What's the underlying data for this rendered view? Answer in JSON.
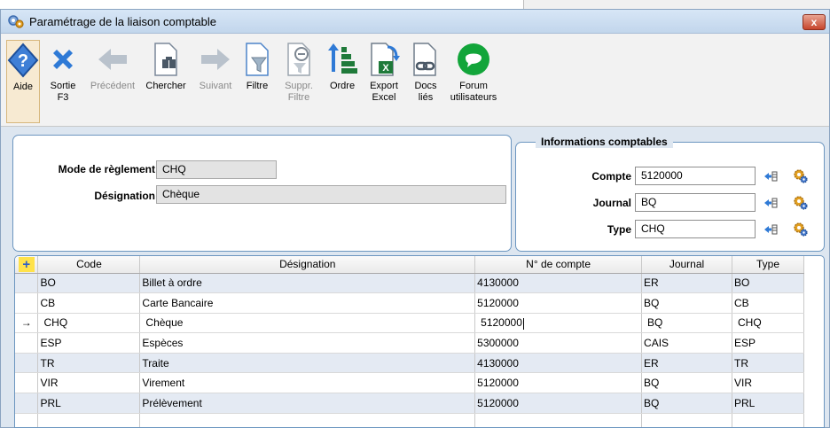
{
  "window": {
    "title": "Paramétrage de la liaison comptable",
    "close_label": "x"
  },
  "toolbar": [
    {
      "label": "Aide",
      "icon": "help-icon",
      "state": "active"
    },
    {
      "label": "Sortie\nF3",
      "icon": "close-x-icon",
      "state": "enabled"
    },
    {
      "label": "Précédent",
      "icon": "arrow-left-icon",
      "state": "disabled"
    },
    {
      "label": "Chercher",
      "icon": "search-doc-icon",
      "state": "enabled"
    },
    {
      "label": "Suivant",
      "icon": "arrow-right-icon",
      "state": "disabled"
    },
    {
      "label": "Filtre",
      "icon": "filter-icon",
      "state": "enabled"
    },
    {
      "label": "Suppr.\nFiltre",
      "icon": "remove-filter-icon",
      "state": "disabled"
    },
    {
      "label": "Ordre",
      "icon": "sort-icon",
      "state": "enabled"
    },
    {
      "label": "Export\nExcel",
      "icon": "excel-export-icon",
      "state": "enabled"
    },
    {
      "label": "Docs\nliés",
      "icon": "linked-docs-icon",
      "state": "enabled"
    },
    {
      "label": "Forum\nutilisateurs",
      "icon": "forum-icon",
      "state": "enabled"
    }
  ],
  "form": {
    "mode_label": "Mode de règlement",
    "mode_value": "CHQ",
    "designation_label": "Désignation",
    "designation_value": "Chèque"
  },
  "accounting": {
    "legend": "Informations comptables",
    "compte_label": "Compte",
    "compte_value": "5120000",
    "journal_label": "Journal",
    "journal_value": "BQ",
    "type_label": "Type",
    "type_value": "CHQ"
  },
  "grid": {
    "columns": [
      "Code",
      "Désignation",
      "N° de compte",
      "Journal",
      "Type"
    ],
    "selected_index": 2,
    "rows": [
      [
        "BO",
        "Billet à ordre",
        "4130000",
        "ER",
        "BO"
      ],
      [
        "CB",
        "Carte Bancaire",
        "5120000",
        "BQ",
        "CB"
      ],
      [
        "CHQ",
        "Chèque",
        "5120000",
        "BQ",
        "CHQ"
      ],
      [
        "ESP",
        "Espèces",
        "5300000",
        "CAIS",
        "ESP"
      ],
      [
        "TR",
        "Traite",
        "4130000",
        "ER",
        "TR"
      ],
      [
        "VIR",
        "Virement",
        "5120000",
        "BQ",
        "VIR"
      ],
      [
        "PRL",
        "Prélèvement",
        "5120000",
        "BQ",
        "PRL"
      ]
    ],
    "row_arrow": "→",
    "add_glyph": "+"
  },
  "colors": {
    "accent": "#2f61c4",
    "excel_green": "#1f7a3a",
    "forum_green": "#12a53a",
    "gear_orange": "#e3a020"
  }
}
